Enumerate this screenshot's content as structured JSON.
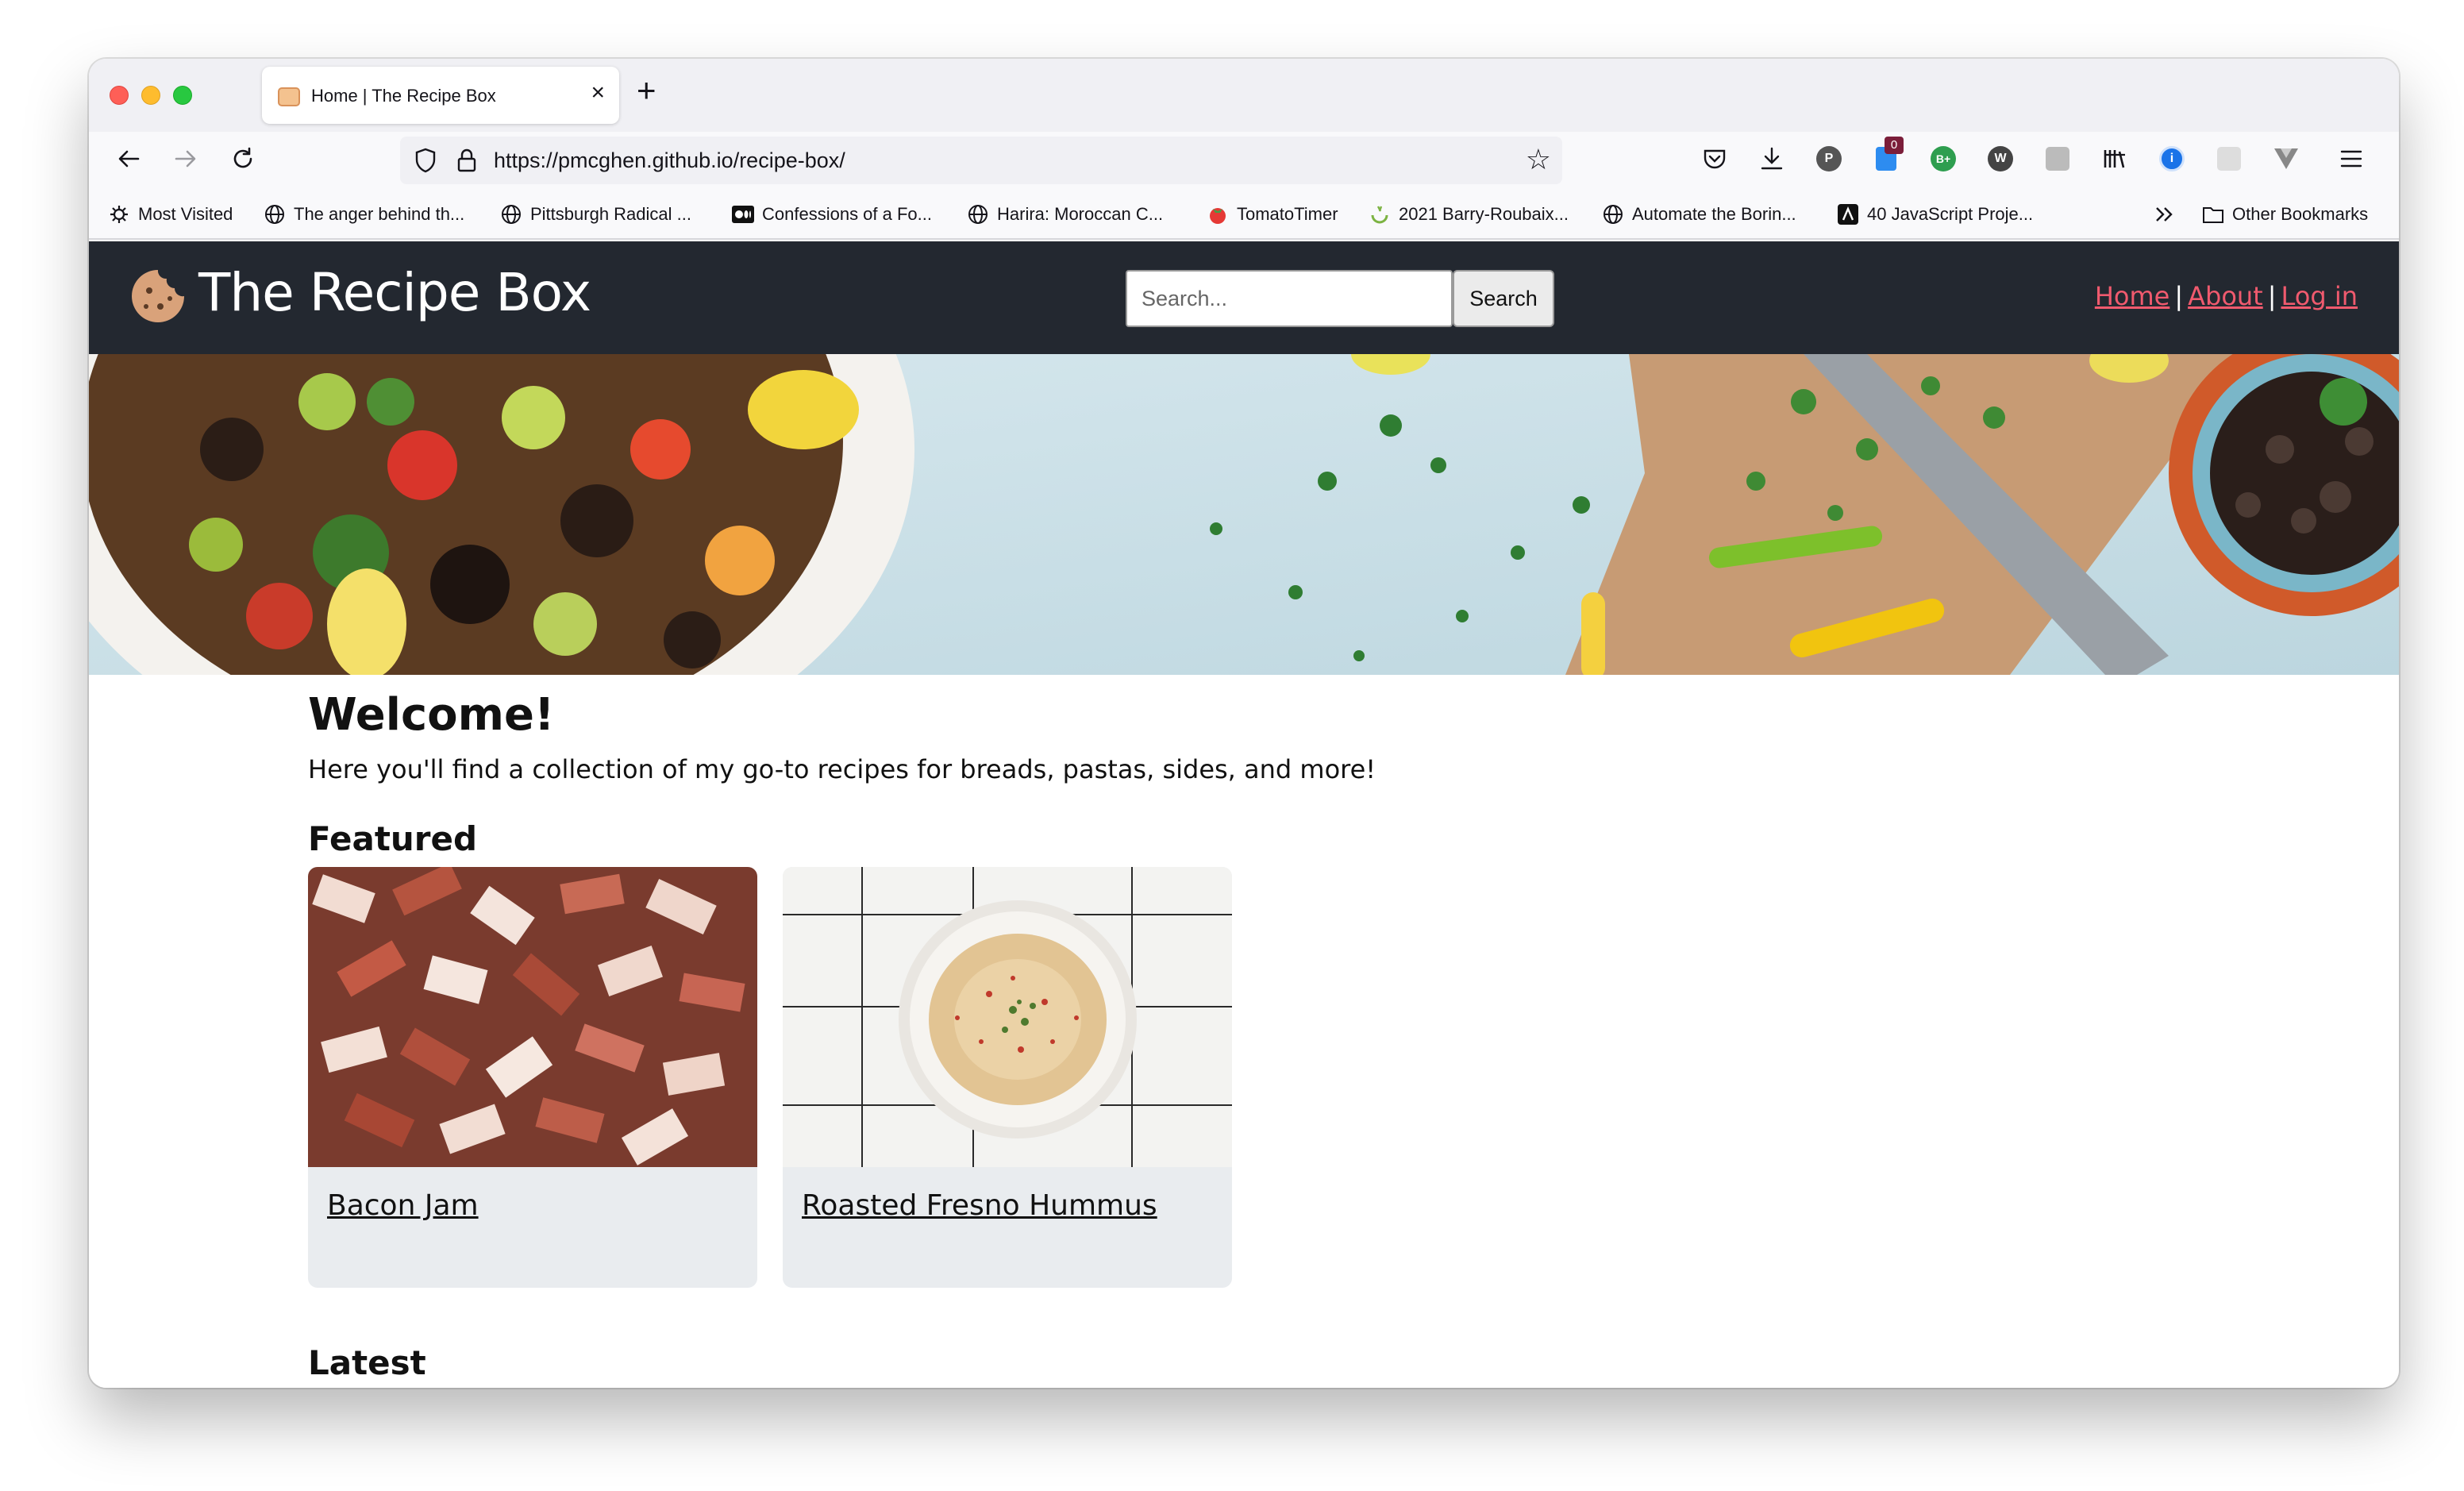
{
  "browser": {
    "tab": {
      "title": "Home | The Recipe Box",
      "close": "×"
    },
    "new_tab": "+",
    "url": "https://pmcghen.github.io/recipe-box/",
    "extensions": {
      "badge_count": "0",
      "pinboard": "P",
      "bplus": "B+"
    },
    "bookmarks": [
      {
        "label": "Most Visited",
        "icon": "gear-icon"
      },
      {
        "label": "The anger behind th...",
        "icon": "globe-icon"
      },
      {
        "label": "Pittsburgh Radical ...",
        "icon": "globe-icon"
      },
      {
        "label": "Confessions of a Fo...",
        "icon": "medium-icon"
      },
      {
        "label": "Harira: Moroccan C...",
        "icon": "globe-icon"
      },
      {
        "label": "TomatoTimer",
        "icon": "tomato-icon"
      },
      {
        "label": "2021 Barry-Roubaix...",
        "icon": "leaf-icon"
      },
      {
        "label": "Automate the Borin...",
        "icon": "globe-icon"
      },
      {
        "label": "40 JavaScript Proje...",
        "icon": "scrimba-icon"
      }
    ],
    "other_bookmarks": "Other Bookmarks"
  },
  "site": {
    "title": "The Recipe Box",
    "search_placeholder": "Search...",
    "search_button": "Search",
    "nav": {
      "home": "Home",
      "about": "About",
      "login": "Log in",
      "separator": "|"
    }
  },
  "main": {
    "welcome": "Welcome!",
    "intro": "Here you'll find a collection of my go-to recipes for breads, pastas, sides, and more!",
    "featured_heading": "Featured",
    "featured": [
      {
        "title": "Bacon Jam"
      },
      {
        "title": "Roasted Fresno Hummus"
      }
    ],
    "latest_heading": "Latest"
  },
  "colors": {
    "navbar_bg": "#232830",
    "link_accent": "#f05a6e",
    "card_bg": "#e9ecef"
  }
}
